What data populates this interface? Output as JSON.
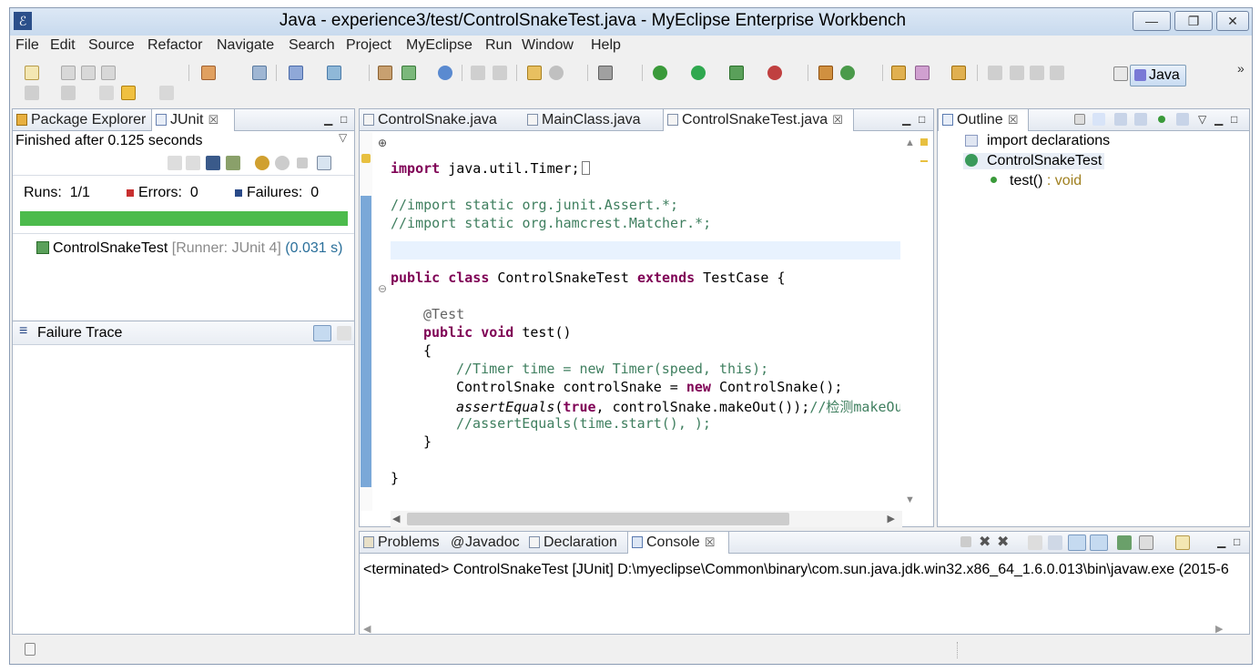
{
  "window": {
    "title": "Java - experience3/test/ControlSnakeTest.java - MyEclipse Enterprise Workbench",
    "min_glyph": "—",
    "max_glyph": "❐",
    "close_glyph": "✕"
  },
  "menu": [
    "File",
    "Edit",
    "Source",
    "Refactor",
    "Navigate",
    "Search",
    "Project",
    "MyEclipse",
    "Run",
    "Window",
    "Help"
  ],
  "perspective": {
    "label": "Java",
    "more": "»"
  },
  "left_pane": {
    "tabs": [
      {
        "label": "Package Explorer"
      },
      {
        "label": "JUnit",
        "close": "☒"
      }
    ],
    "status": "Finished after 0.125 seconds",
    "runs_label": "Runs:",
    "runs_value": "1/1",
    "errors_label": "Errors:",
    "errors_value": "0",
    "failures_label": "Failures:",
    "failures_value": "0",
    "progress_fraction": 1.0,
    "progress_color": "#4cbb4c",
    "test_item": "ControlSnakeTest",
    "test_runner": "[Runner: JUnit 4]",
    "test_time": "(0.031 s)",
    "failure_trace_label": "Failure Trace"
  },
  "editor": {
    "tabs": [
      {
        "label": "ControlSnake.java"
      },
      {
        "label": "MainClass.java"
      },
      {
        "label": "ControlSnakeTest.java",
        "close": "☒"
      }
    ],
    "lines": {
      "import_kw": "import",
      "import_rest": " java.util.Timer;",
      "c1": "//import static org.junit.Assert.*;",
      "c2": "//import static org.hamcrest.Matcher.*;",
      "class_kw1": "public",
      "class_kw2": "class",
      "class_name": " ControlSnakeTest ",
      "class_kw3": "extends",
      "class_rest": " TestCase {",
      "annotation": "@Test",
      "m_kw1": "public",
      "m_kw2": "void",
      "m_rest": " test()",
      "brace_open": "{",
      "c3": "//Timer time = new Timer(speed, this);",
      "l_cs1": "ControlSnake controlSnake = ",
      "l_new": "new",
      "l_cs2": " ControlSnake();",
      "assert_it": "assertEquals",
      "assert_p1": "(",
      "assert_true": "true",
      "assert_rest": ", controlSnake.makeOut());",
      "assert_cm": "//检测makeOu",
      "c4": "//assertEquals(time.start(), );",
      "brace_close_inner": "}",
      "brace_close_outer": "}"
    }
  },
  "outline": {
    "tab": "Outline",
    "close": "☒",
    "items": [
      {
        "label": "import declarations"
      },
      {
        "label": "ControlSnakeTest"
      },
      {
        "label": "test()",
        "type": " : void"
      }
    ]
  },
  "bottom": {
    "tabs": [
      {
        "label": "Problems"
      },
      {
        "label": "Javadoc"
      },
      {
        "label": "Declaration"
      },
      {
        "label": "Console",
        "close": "☒"
      }
    ],
    "console_text": "<terminated> ControlSnakeTest [JUnit] D:\\myeclipse\\Common\\binary\\com.sun.java.jdk.win32.x86_64_1.6.0.013\\bin\\javaw.exe (2015-6"
  }
}
